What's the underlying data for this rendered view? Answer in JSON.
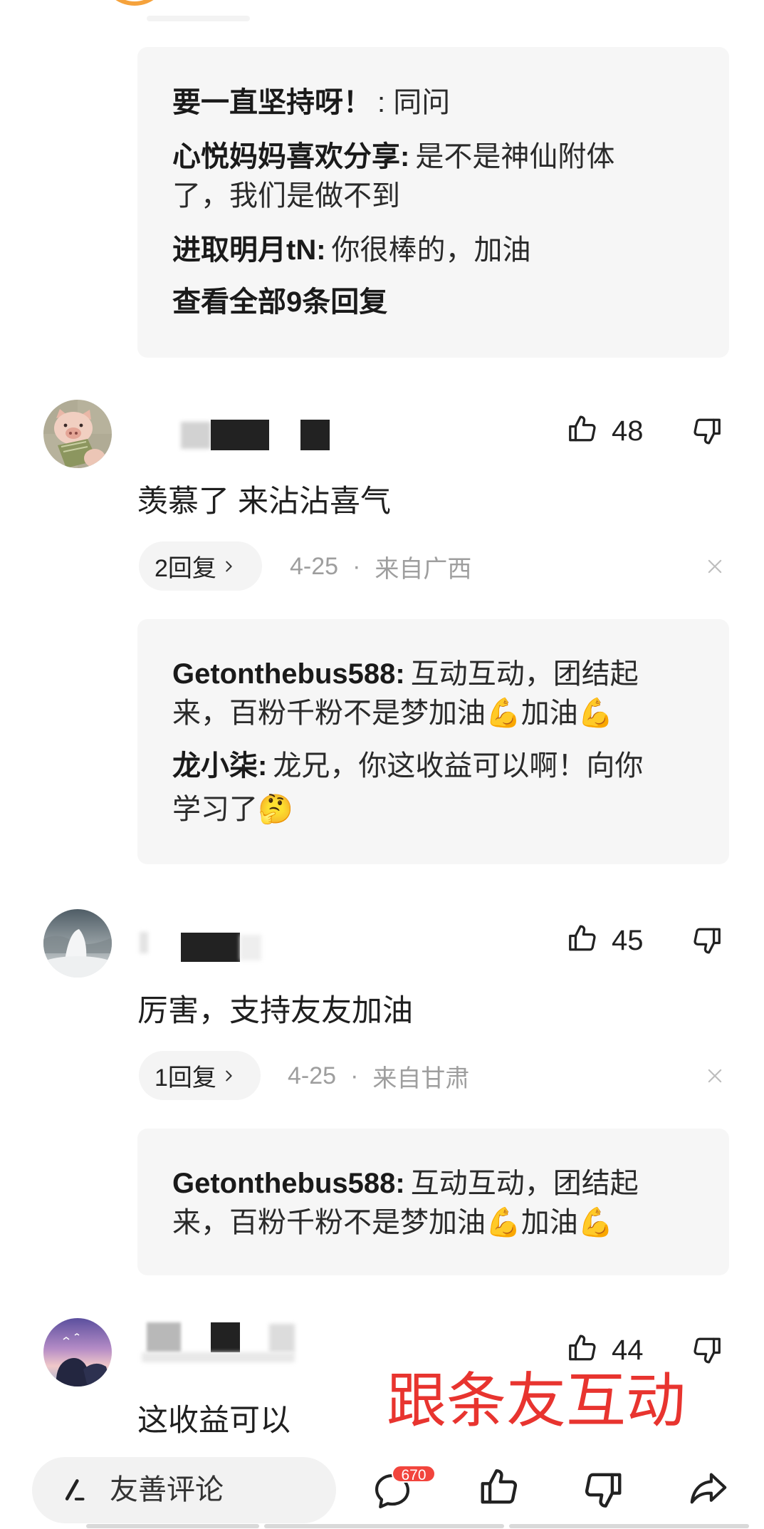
{
  "thread_top": {
    "replies": [
      {
        "name": "要一直坚持呀！",
        "lines": [
          ": 同问"
        ]
      },
      {
        "name": "心悦妈妈喜欢分享:",
        "lines": [
          "是不是神仙附体",
          "了，我们是做不到"
        ]
      },
      {
        "name": "进取明月tN:",
        "lines": [
          "你很棒的，加油"
        ]
      }
    ],
    "view_all": "查看全部9条回复"
  },
  "comments": [
    {
      "like_count": "48",
      "text": "羡慕了 来沾沾喜气",
      "reply_button": "2回复",
      "date": "4-25",
      "separator": "·",
      "location": "来自广西",
      "replies": [
        {
          "name": "Getonthebus588:",
          "lines": [
            "互动互动，团结起",
            "来，百粉千粉不是梦加油💪加油💪"
          ]
        },
        {
          "name": "龙小柒:",
          "lines": [
            "龙兄，你这收益可以啊！向你",
            "学习了🤔"
          ]
        }
      ]
    },
    {
      "like_count": "45",
      "text": "厉害，支持友友加油",
      "reply_button": "1回复",
      "date": "4-25",
      "separator": "·",
      "location": "来自甘肃",
      "replies": [
        {
          "name": "Getonthebus588:",
          "lines": [
            "互动互动，团结起",
            "来，百粉千粉不是梦加油💪加油💪"
          ]
        }
      ]
    },
    {
      "like_count": "44",
      "text": "这收益可以"
    }
  ],
  "overlay_caption": "跟条友互动",
  "bottom_bar": {
    "input_placeholder": "友善评论",
    "comment_badge": "670"
  },
  "icons": {
    "like": "thumbs-up-icon",
    "dislike": "thumbs-down-icon",
    "close": "close-icon",
    "reply_chevron": "chevron-right-icon",
    "compose": "pen-icon",
    "comments": "comment-bubble-icon",
    "share": "share-arrow-icon"
  },
  "colors": {
    "caption_red": "#e8342f",
    "badge_red": "#f2453d",
    "reply_box_bg": "#f6f6f6",
    "meta_grey": "#9e9e9e",
    "avatar_ring_orange": "#f5a23c"
  }
}
